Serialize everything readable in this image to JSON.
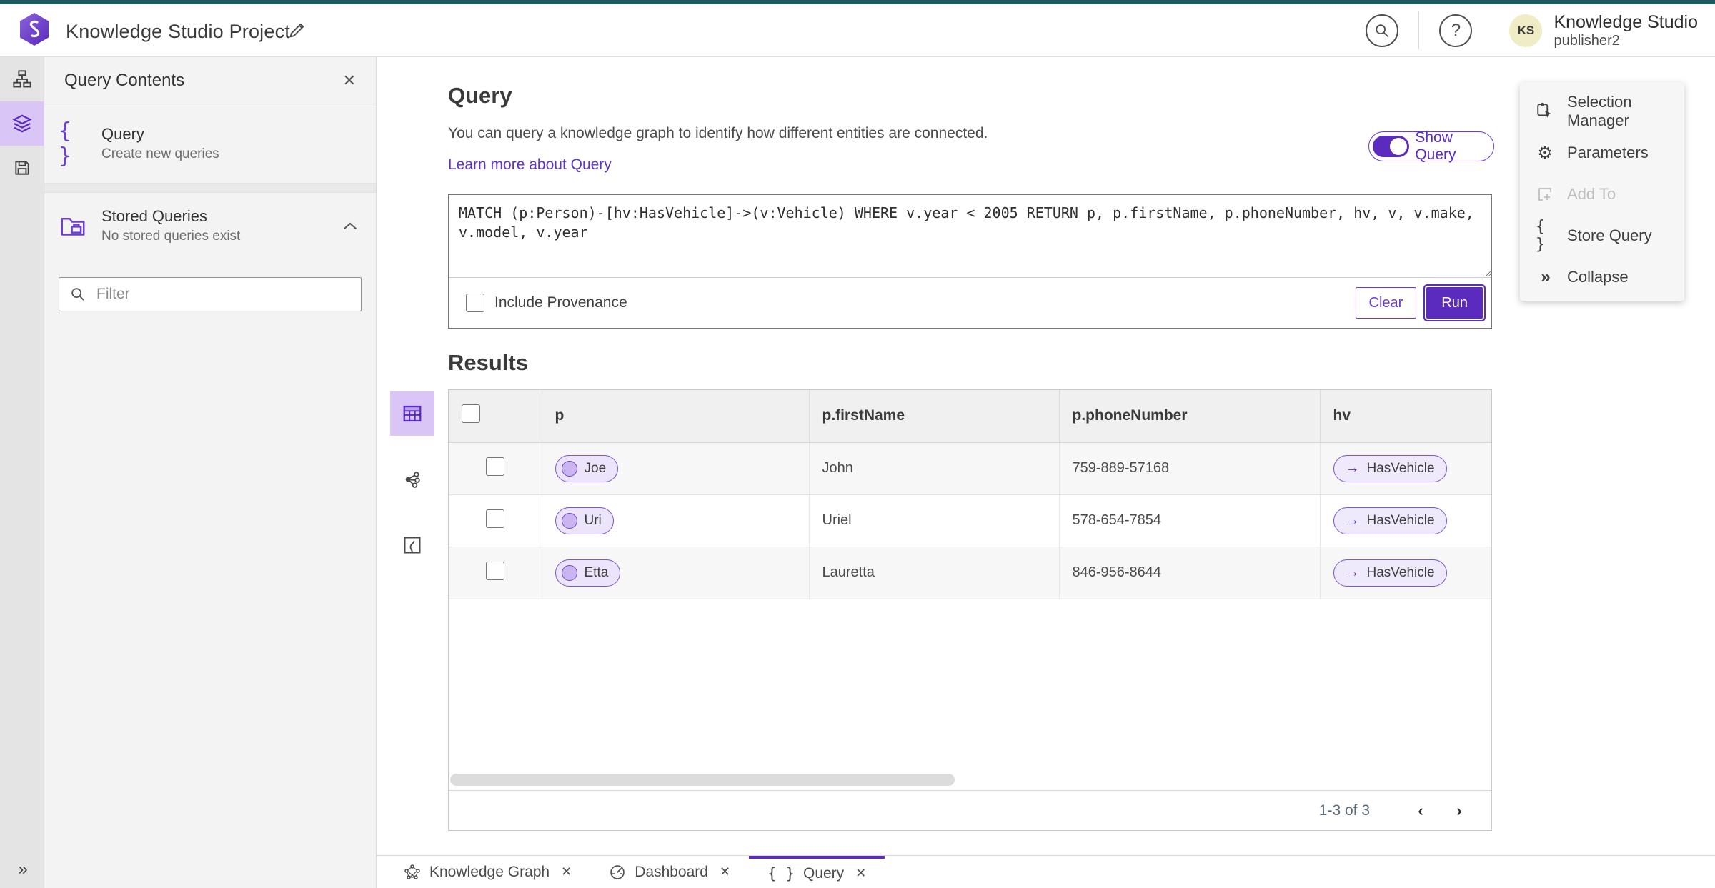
{
  "colors": {
    "accent_purple": "#5b2abe",
    "accent_purple_border": "#7b57cc",
    "accent_purple_light": "#d9c6f6",
    "pill_background": "#ece4fa",
    "top_strip_teal": "#1d5a5f",
    "panel_gray": "#f3f3f3",
    "rail_gray": "#e4e4e4",
    "avatar_background": "#f0ecc6"
  },
  "header": {
    "app_title": "Knowledge Studio Project",
    "user_name": "Knowledge Studio",
    "user_role": "publisher2",
    "avatar_initials": "KS"
  },
  "rail": {
    "expand_glyph": "»"
  },
  "left_panel": {
    "title": "Query Contents",
    "close_glyph": "✕",
    "query_item": {
      "icon": "{ }",
      "label": "Query",
      "sublabel": "Create new queries"
    },
    "stored_queries": {
      "label": "Stored Queries",
      "sublabel": "No stored queries exist"
    },
    "filter_placeholder": "Filter"
  },
  "main": {
    "title": "Query",
    "description": "You can query a knowledge graph to identify how different entities are connected.",
    "learn_more_label": "Learn more about Query",
    "show_query_label": "Show Query",
    "query_text": "MATCH (p:Person)-[hv:HasVehicle]->(v:Vehicle) WHERE v.year < 2005 RETURN p, p.firstName, p.phoneNumber, hv, v, v.make, v.model, v.year",
    "include_provenance_label": "Include Provenance",
    "clear_label": "Clear",
    "run_label": "Run",
    "results_title": "Results"
  },
  "results_table": {
    "columns": {
      "c0": "p",
      "c1": "p.firstName",
      "c2": "p.phoneNumber",
      "c3": "hv"
    },
    "rows": [
      {
        "p": "Joe",
        "firstName": "John",
        "phoneNumber": "759-889-57168",
        "hv": "HasVehicle"
      },
      {
        "p": "Uri",
        "firstName": "Uriel",
        "phoneNumber": "578-654-7854",
        "hv": "HasVehicle"
      },
      {
        "p": "Etta",
        "firstName": "Lauretta",
        "phoneNumber": "846-956-8644",
        "hv": "HasVehicle"
      }
    ],
    "edge_arrow": "→",
    "pagination": {
      "range_label": "1-3 of 3",
      "prev_glyph": "‹",
      "next_glyph": "›"
    }
  },
  "right_panel": {
    "items": [
      {
        "label": "Selection Manager"
      },
      {
        "label": "Parameters"
      },
      {
        "label": "Add To"
      },
      {
        "label": "Store Query"
      },
      {
        "label": "Collapse"
      }
    ],
    "braces_glyph": "{ }",
    "collapse_glyph": "»",
    "gear_glyph": "⚙"
  },
  "bottom_tabs": {
    "tabs": [
      {
        "label": "Knowledge Graph"
      },
      {
        "label": "Dashboard"
      },
      {
        "label": "Query"
      }
    ],
    "close_glyph": "✕",
    "query_braces": "{ }"
  }
}
